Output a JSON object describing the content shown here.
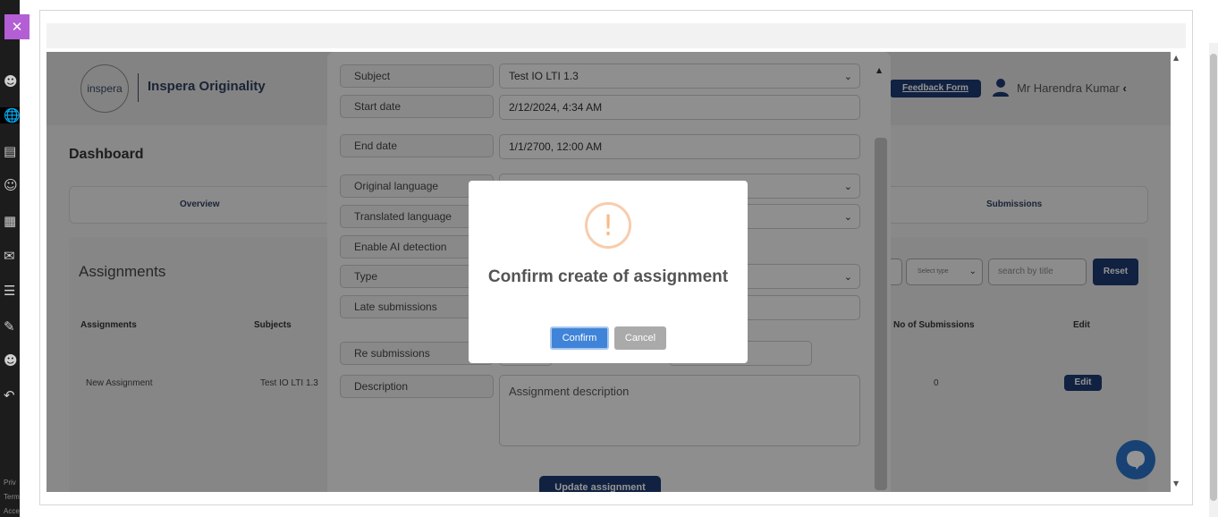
{
  "rail": {
    "close_glyph": "✕",
    "icons": [
      "user-icon",
      "globe-icon",
      "courses-icon",
      "groups-icon",
      "calendar-icon",
      "inbox-icon",
      "history-icon",
      "commons-icon",
      "account-icon",
      "logout-icon"
    ],
    "footer": [
      "Priv",
      "Term",
      "Acce"
    ]
  },
  "app": {
    "logo_text": "inspera",
    "brand": "Inspera Originality",
    "feedback_label": "Feedback Form",
    "user_name": "Mr Harendra Kumar",
    "user_caret": "‹",
    "dashboard_title": "Dashboard",
    "tabs": [
      "Overview",
      "Submissions"
    ],
    "assignments_title": "Assignments",
    "select_type_placeholder": "Select type",
    "search_placeholder": "search by title",
    "reset_label": "Reset",
    "columns": [
      "Assignments",
      "Subjects",
      "No of Submissions",
      "Edit"
    ],
    "rows": [
      {
        "assignment": "New Assignment",
        "subject": "Test IO LTI 1.3",
        "submissions": "0",
        "edit_label": "Edit"
      }
    ]
  },
  "form": {
    "fields": [
      {
        "label": "Subject",
        "value": "Test IO LTI 1.3",
        "dropdown": true
      },
      {
        "label": "Start date",
        "value": "2/12/2024, 4:34 AM",
        "dropdown": false
      },
      {
        "label": "End date",
        "value": "1/1/2700, 12:00 AM",
        "dropdown": false
      },
      {
        "label": "Original language",
        "value": "",
        "dropdown": true
      },
      {
        "label": "Translated language",
        "value": "",
        "dropdown": true
      },
      {
        "label": "Enable AI detection",
        "value": "",
        "dropdown": false
      },
      {
        "label": "Type",
        "value": "",
        "dropdown": true
      },
      {
        "label": "Late submissions",
        "value": "",
        "dropdown": false
      },
      {
        "label": "Re submissions",
        "value": "",
        "dropdown": false
      },
      {
        "label": "Description",
        "value": "",
        "dropdown": false
      }
    ],
    "description_placeholder": "Assignment description",
    "update_label": "Update assignment"
  },
  "modal": {
    "icon_glyph": "!",
    "title": "Confirm create of assignment",
    "confirm_label": "Confirm",
    "cancel_label": "Cancel"
  },
  "colors": {
    "brand_navy": "#1d3970",
    "confirm_blue": "#3f84d8",
    "warning_orange": "#f8bb86",
    "rail_accent": "#b35ed4"
  }
}
